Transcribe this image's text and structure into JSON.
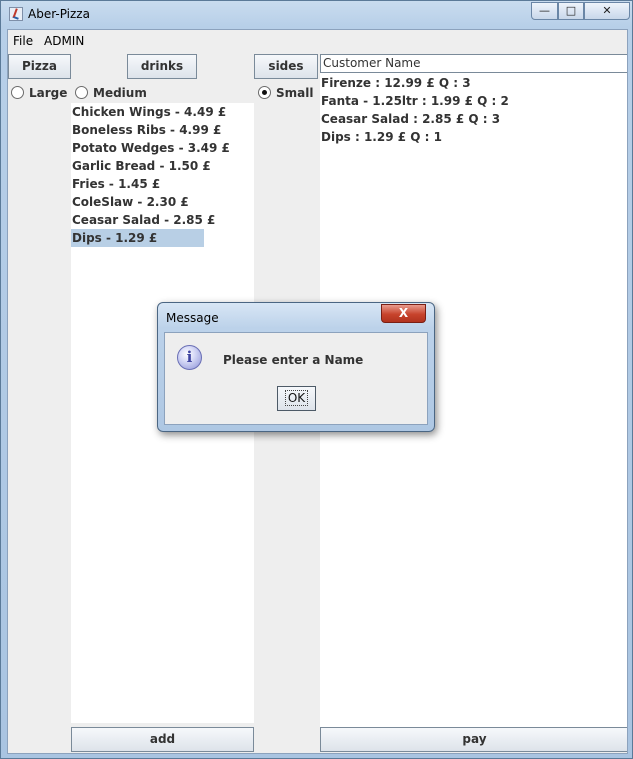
{
  "window": {
    "title": "Aber-Pizza",
    "minimize_glyph": "—",
    "maximize_glyph": "□",
    "close_glyph": "✕"
  },
  "menu": [
    "File",
    "ADMIN"
  ],
  "categories": {
    "pizza": "Pizza",
    "drinks": "drinks",
    "sides": "sides"
  },
  "sizes": [
    {
      "label": "Large",
      "selected": false
    },
    {
      "label": "Medium",
      "selected": false
    },
    {
      "label": "Small",
      "selected": true
    }
  ],
  "menu_items": [
    "Chicken Wings - 4.49 £",
    "Boneless Ribs - 4.99 £",
    "Potato Wedges - 3.49 £",
    "Garlic Bread - 1.50 £",
    "Fries - 1.45 £",
    "ColeSlaw - 2.30 £",
    "Ceasar Salad - 2.85 £",
    "Dips - 1.29 £"
  ],
  "selected_item_index": 7,
  "customer_name_placeholder": "Customer Name",
  "order_lines": [
    "Firenze : 12.99 £  Q : 3",
    "Fanta - 1.25ltr : 1.99 £  Q : 2",
    "Ceasar Salad : 2.85 £  Q : 3",
    "Dips : 1.29 £  Q : 1"
  ],
  "buttons": {
    "add": "add",
    "pay": "pay"
  },
  "dialog": {
    "title": "Message",
    "message": "Please enter a Name",
    "ok": "OK",
    "close_glyph": "X",
    "icon_glyph": "i"
  },
  "colors": {
    "selection": "#b8cfe5",
    "panel_bg": "#eeeeee",
    "dialog_close": "#c7432c"
  }
}
